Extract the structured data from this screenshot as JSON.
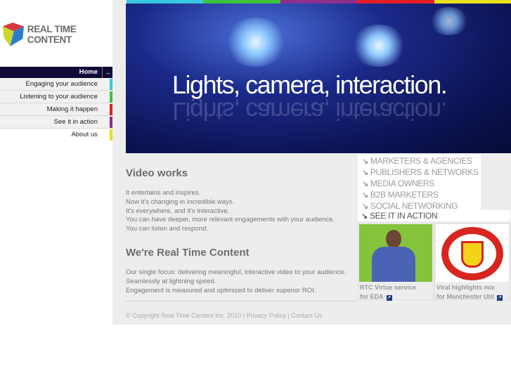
{
  "brand": {
    "name": "REAL TIME CONTENT"
  },
  "nav": [
    {
      "label": "Home",
      "color": "#100a38"
    },
    {
      "label": "Engaging your audience",
      "color": "#35c8e0"
    },
    {
      "label": "Listening to your audience",
      "color": "#3cc23c"
    },
    {
      "label": "Making it happen",
      "color": "#e41e26"
    },
    {
      "label": "See it in action",
      "color": "#8d2f8f"
    },
    {
      "label": "About us",
      "color": "#e8e01a"
    }
  ],
  "stripe_colors": [
    "#35c8e0",
    "#3cc23c",
    "#8d2f8f",
    "#e41e26",
    "#e8e01a"
  ],
  "hero": {
    "tagline": "Lights, camera, interaction."
  },
  "main": {
    "h1": "Video works",
    "p1": [
      "It entertains and inspires.",
      "Now it's changing in incredible ways.",
      "It's everywhere, and it's interactive.",
      "You can have deeper, more relevant engagements with your audience.",
      "You can listen and respond."
    ],
    "h2": "We're Real Time Content",
    "p2": [
      "Our single focus: delivering meaningful, interactive video to your audience.",
      "Seamlessly at lightning speed.",
      "Engagement is measured and optimized to deliver superior ROI."
    ]
  },
  "footer": {
    "copyright": "© Copyright Real Time Content Inc. 2010",
    "privacy": "Privacy Policy",
    "contact": "Contact Us"
  },
  "markets": [
    "MARKETERS & AGENCIES",
    "PUBLISHERS & NETWORKS",
    "MEDIA OWNERS",
    "B2B MARKETERS",
    "SOCIAL NETWORKING"
  ],
  "see_it": "SEE IT IN ACTION",
  "cards": [
    {
      "line1": "RTC Virtue service",
      "line2": "for EDA"
    },
    {
      "line1": "Viral highlights mix",
      "line2": "for Manchester Utd"
    }
  ]
}
